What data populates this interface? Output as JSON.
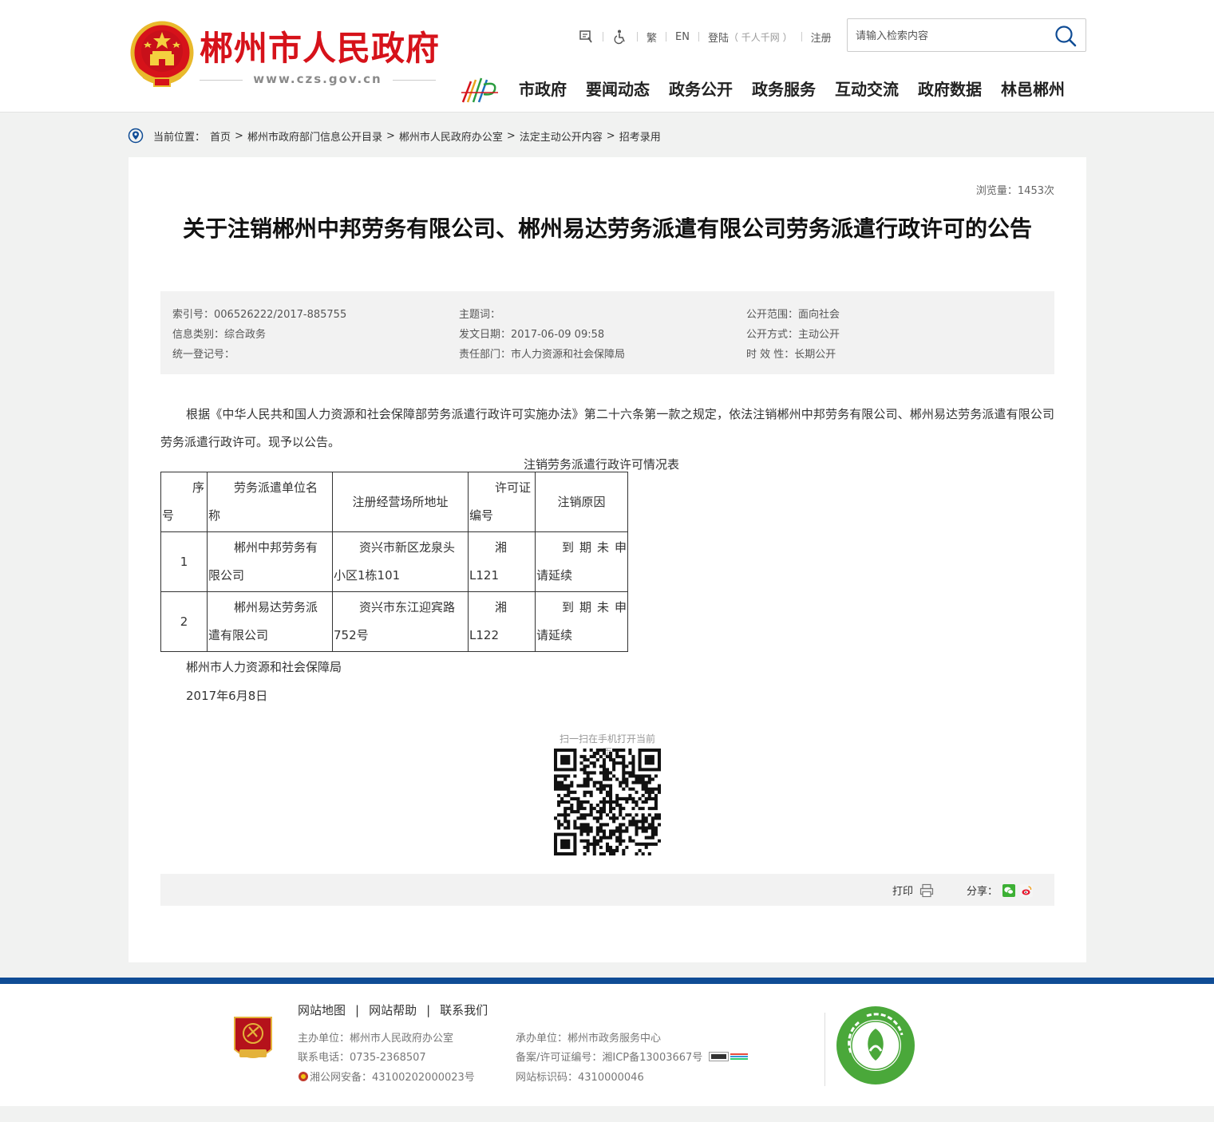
{
  "header": {
    "site_title": "郴州市人民政府",
    "site_url": "www.czs.gov.cn",
    "toplinks": {
      "traditional": "繁",
      "english": "EN",
      "login": "登陆",
      "login_note": "（ 千人千网 ）",
      "register": "注册"
    },
    "search_placeholder": "请输入检索内容",
    "nav": [
      "市政府",
      "要闻动态",
      "政务公开",
      "政务服务",
      "互动交流",
      "政府数据",
      "林邑郴州"
    ]
  },
  "breadcrumb": {
    "label": "当前位置：",
    "items": [
      "首页",
      "郴州市政府部门信息公开目录",
      "郴州市人民政府办公室",
      "法定主动公开内容",
      "招考录用"
    ],
    "separator": ">"
  },
  "article": {
    "views": "浏览量：1453次",
    "title": "关于注销郴州中邦劳务有限公司、郴州易达劳务派遣有限公司劳务派遣行政许可的公告",
    "meta": {
      "index_no": "索引号：006526222/2017-885755",
      "subject": "主题词：",
      "scope": "公开范围：面向社会",
      "category": "信息类别：综合政务",
      "date": "发文日期：2017-06-09 09:58",
      "method": "公开方式：主动公开",
      "reg_no": "统一登记号：",
      "department": "责任部门：市人力资源和社会保障局",
      "validity": "时 效 性：长期公开"
    },
    "body": "根据《中华人民共和国人力资源和社会保障部劳务派遣行政许可实施办法》第二十六条第一款之规定，依法注销郴州中邦劳务有限公司、郴州易达劳务派遣有限公司劳务派遣行政许可。现予以公告。",
    "table_caption": "注销劳务派遣行政许可情况表",
    "table": {
      "headers": {
        "seq_1": "序",
        "seq_2": "号",
        "name_1": "劳务派遣单位名",
        "name_2": "称",
        "address": "注册经营场所地址",
        "license_1": "许可证",
        "license_2": "编号",
        "reason": "注销原因"
      },
      "rows": [
        {
          "seq": "1",
          "name_1": "郴州中邦劳务有",
          "name_2": "限公司",
          "address_1": "资兴市新区龙泉头",
          "address_2": "小区1栋101",
          "license_1": "湘",
          "license_2": "L121",
          "reason_1": "到期未申",
          "reason_2": "请延续"
        },
        {
          "seq": "2",
          "name_1": "郴州易达劳务派",
          "name_2": "遣有限公司",
          "address_1": "资兴市东江迎宾路",
          "address_2": "752号",
          "license_1": "湘",
          "license_2": "L122",
          "reason_1": "到期未申",
          "reason_2": "请延续"
        }
      ]
    },
    "signature": "郴州市人力资源和社会保障局",
    "sign_date": "2017年6月8日",
    "qr_label": "扫一扫在手机打开当前页",
    "print_label": "打印",
    "share_label": "分享："
  },
  "footer": {
    "links": [
      "网站地图",
      "网站帮助",
      "联系我们"
    ],
    "organizer": "主办单位：郴州市人民政府办公室",
    "undertaker": "承办单位：郴州市政务服务中心",
    "phone": "联系电话：0735-2368507",
    "icp": "备案/许可证编号：湘ICP备13003667号",
    "police": "湘公网安备：43100202000023号",
    "site_code": "网站标识码：4310000046"
  },
  "colors": {
    "brand_red": "#d6121a",
    "footer_blue": "#0f4c95",
    "meta_bg": "#f2f2f2"
  }
}
